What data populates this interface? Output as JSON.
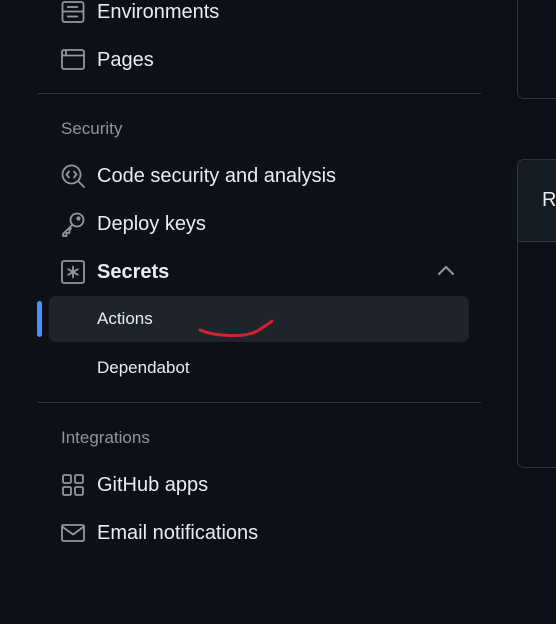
{
  "sidebar": {
    "top_items": [
      {
        "label": "Environments",
        "icon": "server-icon"
      },
      {
        "label": "Pages",
        "icon": "browser-icon"
      }
    ],
    "security_section": {
      "heading": "Security",
      "items": [
        {
          "label": "Code security and analysis",
          "icon": "codescan-icon"
        },
        {
          "label": "Deploy keys",
          "icon": "key-icon"
        },
        {
          "label": "Secrets",
          "icon": "asterisk-box-icon",
          "expanded": true
        }
      ],
      "secrets_children": [
        {
          "label": "Actions",
          "active": true
        },
        {
          "label": "Dependabot",
          "active": false
        }
      ]
    },
    "integrations_section": {
      "heading": "Integrations",
      "items": [
        {
          "label": "GitHub apps",
          "icon": "apps-grid-icon"
        },
        {
          "label": "Email notifications",
          "icon": "mail-icon"
        }
      ]
    }
  },
  "right_panel": {
    "header_text": "R"
  },
  "colors": {
    "background": "#0d1117",
    "text": "#e6edf3",
    "muted": "#8d96a0",
    "border": "#30363d",
    "active_bg": "#1f242c",
    "accent": "#4493f8",
    "annotation": "#d1242f"
  }
}
